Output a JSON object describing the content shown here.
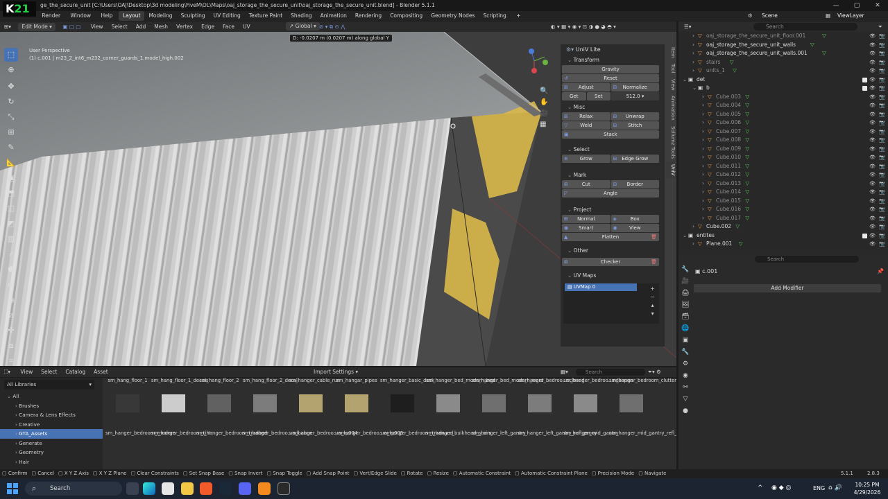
{
  "app": {
    "title": "ge_the_secure_unit [C:\\Users\\OAJ\\Desktop\\3d modeling\\FiveM\\OL\\Maps\\oaj_storage_the_secure_unit\\oaj_storage_the_secure_unit.blend] - Blender 5.1.1",
    "logo_text": "21"
  },
  "menu": [
    "Render",
    "Window",
    "Help"
  ],
  "workspaces": [
    "Layout",
    "Modeling",
    "Sculpting",
    "UV Editing",
    "Texture Paint",
    "Shading",
    "Animation",
    "Rendering",
    "Compositing",
    "Geometry Nodes",
    "Scripting"
  ],
  "active_workspace": "Layout",
  "scene": "Scene",
  "view_layer": "ViewLayer",
  "viewport_header": {
    "mode": "Edit Mode",
    "menus": [
      "View",
      "Select",
      "Add",
      "Mesh",
      "Vertex",
      "Edge",
      "Face",
      "UV"
    ],
    "orientation": "Global"
  },
  "viewport": {
    "perspective": "User Perspective",
    "object": "(1) c.001 | m23_2_int6_m232_corner_guards_1.model_high.002",
    "transform_tip": "D: -0.0207 m (0.0207 m) along global Y"
  },
  "npanel": {
    "title": "UniV Lite",
    "tabs": [
      "Item",
      "Tool",
      "View",
      "Animation",
      "Sollumz Tools",
      "UniV"
    ],
    "transform": {
      "header": "Transform",
      "gravity": "Gravity",
      "reset": "Reset",
      "adjust": "Adjust",
      "normalize": "Normalize",
      "get": "Get",
      "set": "Set",
      "value": "512.0"
    },
    "misc": {
      "header": "Misc",
      "relax": "Relax",
      "unwrap": "Unwrap",
      "weld": "Weld",
      "stitch": "Stitch",
      "stack": "Stack"
    },
    "select": {
      "header": "Select",
      "grow": "Grow",
      "edge_grow": "Edge Grow"
    },
    "mark": {
      "header": "Mark",
      "cut": "Cut",
      "border": "Border",
      "angle": "Angle"
    },
    "project": {
      "header": "Project",
      "normal": "Normal",
      "box": "Box",
      "smart": "Smart",
      "view": "View",
      "flatten": "Flatten"
    },
    "other": {
      "header": "Other",
      "checker": "Checker"
    },
    "uvmaps": {
      "header": "UV Maps",
      "item": "UVMap 0"
    }
  },
  "outliner": {
    "search_placeholder": "Search",
    "rows": [
      {
        "label": "oaj_storage_the_secure_unit_floor.001",
        "indent": 1,
        "dim": true
      },
      {
        "label": "oaj_storage_the_secure_unit_walls",
        "indent": 1,
        "dim": false
      },
      {
        "label": "oaj_storage_the_secure_unit_walls.001",
        "indent": 1,
        "dim": false
      },
      {
        "label": "stairs",
        "indent": 1,
        "dim": true
      },
      {
        "label": "units_1",
        "indent": 1,
        "dim": true
      },
      {
        "label": "det",
        "indent": 0,
        "dim": false
      },
      {
        "label": "b",
        "indent": 1,
        "dim": false
      },
      {
        "label": "Cube.003",
        "indent": 2,
        "dim": true
      },
      {
        "label": "Cube.004",
        "indent": 2,
        "dim": true
      },
      {
        "label": "Cube.005",
        "indent": 2,
        "dim": true
      },
      {
        "label": "Cube.006",
        "indent": 2,
        "dim": true
      },
      {
        "label": "Cube.007",
        "indent": 2,
        "dim": true
      },
      {
        "label": "Cube.008",
        "indent": 2,
        "dim": true
      },
      {
        "label": "Cube.009",
        "indent": 2,
        "dim": true
      },
      {
        "label": "Cube.010",
        "indent": 2,
        "dim": true
      },
      {
        "label": "Cube.011",
        "indent": 2,
        "dim": true
      },
      {
        "label": "Cube.012",
        "indent": 2,
        "dim": true
      },
      {
        "label": "Cube.013",
        "indent": 2,
        "dim": true
      },
      {
        "label": "Cube.014",
        "indent": 2,
        "dim": true
      },
      {
        "label": "Cube.015",
        "indent": 2,
        "dim": true
      },
      {
        "label": "Cube.016",
        "indent": 2,
        "dim": true
      },
      {
        "label": "Cube.017",
        "indent": 2,
        "dim": true
      },
      {
        "label": "Cube.002",
        "indent": 1,
        "dim": false
      },
      {
        "label": "entites",
        "indent": 0,
        "dim": false
      },
      {
        "label": "Plane.001",
        "indent": 1,
        "dim": false
      }
    ]
  },
  "properties": {
    "search_placeholder": "Search",
    "object": "c.001",
    "add_modifier": "Add Modifier"
  },
  "asset_browser": {
    "menus": [
      "View",
      "Select",
      "Catalog",
      "Asset"
    ],
    "import_settings": "Import Settings",
    "search_placeholder": "Search",
    "library": "All Libraries",
    "catalogs": [
      "All",
      "Brushes",
      "Camera & Lens Effects",
      "Creative",
      "GTA_Assets",
      "Generate",
      "Geometry",
      "Hair"
    ],
    "selected_catalog": "GTA_Assets",
    "row1": [
      "sm_hang_floor_1",
      "sm_hang_floor_1_decals",
      "sm_hang_floor_2",
      "sm_hang_floor_2_decal",
      "sm_hanger_cable_run",
      "sm_hangar_pipes",
      "sm_hanger_basic_desk",
      "sm_hanger_bed_modern_bed",
      "sm_hanger_bed_modern_ward",
      "sm_hanger_bedroo...sclosed",
      "sm_hanger_bedroo...ndsopen",
      "sm_hanger_bedroom_clutter"
    ],
    "row2": [
      "sm_hanger_bedroom_modern",
      "sm_hanger_bedroom_tint",
      "sm_hanger_bedroom_tradbed",
      "sm_hanger_bedroo...adcabon",
      "sm_hanger_bedroo...amp004",
      "sm_hanger_bedroo...amp005",
      "sm_hanger_bedroom_tradward",
      "sm_hanger_bulkhead_stairs",
      "sm_hanger_left_gantry",
      "sm_hanger_left_gantry_refl_proxy",
      "sm_hanger_mid_gantry",
      "sm_hanger_mid_gantry_refl_proxy"
    ]
  },
  "statusbar": {
    "items": [
      "Confirm",
      "Cancel",
      "X Y Z Axis",
      "X Y Z Plane",
      "Clear Constraints",
      "Set Snap Base",
      "Snap Invert",
      "Snap Toggle",
      "Add Snap Point",
      "Vert/Edge Slide",
      "Rotate",
      "Resize",
      "Automatic Constraint",
      "Automatic Constraint Plane",
      "Precision Mode",
      "Navigate"
    ],
    "version": "5.1.1",
    "stat": "2.8.3"
  },
  "taskbar": {
    "search": "Search",
    "lang": "ENG",
    "time": "10:25 PM",
    "date": "4/29/2026"
  }
}
